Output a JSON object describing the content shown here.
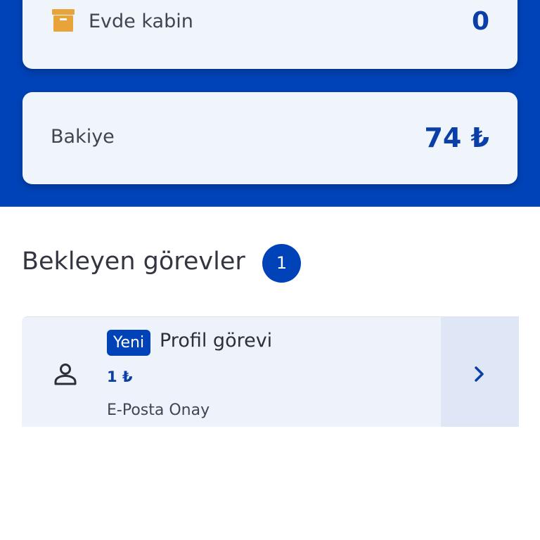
{
  "stats": {
    "cabin": {
      "label": "Evde kabin",
      "value": "0",
      "icon": "archive-box-icon"
    },
    "balance": {
      "label": "Bakiye",
      "value": "74 ₺"
    }
  },
  "pending_tasks": {
    "title": "Bekleyen görevler",
    "count": "1",
    "items": [
      {
        "tag": "Yeni",
        "title": "Profil görevi",
        "reward": "1 ₺",
        "subtitle": "E-Posta Onay",
        "icon": "person-icon"
      }
    ]
  },
  "colors": {
    "primary": "#0043b8",
    "accent_text": "#0b3fa8",
    "card_bg": "#f0f4fb",
    "icon_orange": "#e8a33a"
  }
}
